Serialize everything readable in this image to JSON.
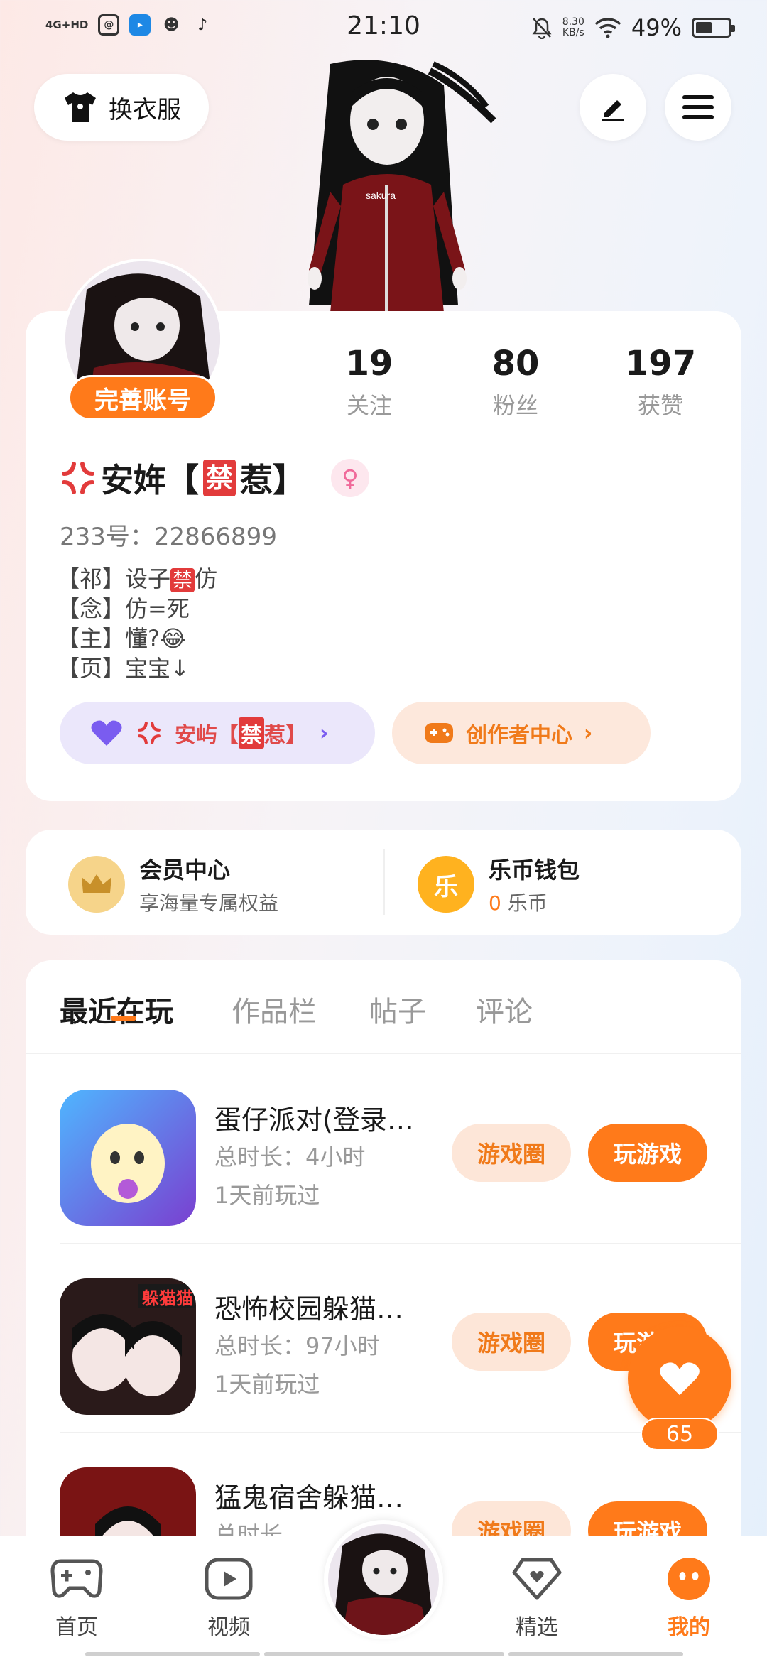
{
  "status_bar": {
    "network": "4G+HD",
    "time": "21:10",
    "speed_value": "8.30",
    "speed_unit": "KB/s",
    "battery": "49%"
  },
  "top": {
    "dress_label": "换衣服"
  },
  "profile": {
    "complete_label": "完善账号",
    "stats": [
      {
        "value": "19",
        "label": "关注"
      },
      {
        "value": "80",
        "label": "粉丝"
      },
      {
        "value": "197",
        "label": "获赞"
      }
    ],
    "name_part1": "安姩【",
    "name_chip": "禁",
    "name_part2": "惹】",
    "uid": "233号：22866899",
    "bio": [
      {
        "prefix": "【祁】设子",
        "chip": "禁",
        "suffix": "仿"
      },
      {
        "prefix": "【念】仿=死",
        "chip": "",
        "suffix": ""
      },
      {
        "prefix": "【主】懂?😂",
        "chip": "",
        "suffix": ""
      },
      {
        "prefix": "【页】宝宝↓",
        "chip": "",
        "suffix": ""
      }
    ],
    "group_pill": {
      "part1": "安屿【",
      "chip": "禁",
      "part2": "惹】"
    },
    "creator_pill": "创作者中心"
  },
  "vip": {
    "member_title": "会员中心",
    "member_sub": "享海量专属权益",
    "wallet_title": "乐币钱包",
    "wallet_amount": "0",
    "wallet_unit": "乐币",
    "wallet_icon_char": "乐"
  },
  "tabs": [
    "最近在玩",
    "作品栏",
    "帖子",
    "评论"
  ],
  "games": [
    {
      "name": "蛋仔派对(登录…",
      "duration": "总时长：4小时",
      "last": "1天前玩过",
      "circle_label": "游戏圈",
      "play_label": "玩游戏",
      "icon_text": ""
    },
    {
      "name": "恐怖校园躲猫…",
      "duration": "总时长：97小时",
      "last": "1天前玩过",
      "circle_label": "游戏圈",
      "play_label": "玩游戏",
      "icon_text": "躲猫猫"
    },
    {
      "name": "猛鬼宿舍躲猫…",
      "duration": "总时长",
      "last": "",
      "circle_label": "游戏圈",
      "play_label": "玩游戏",
      "icon_text": ""
    }
  ],
  "fab": {
    "count": "65"
  },
  "bottom_nav": [
    {
      "label": "首页"
    },
    {
      "label": "视频"
    },
    {
      "label": "精选"
    },
    {
      "label": "我的"
    }
  ],
  "colors": {
    "accent": "#ff7a1a",
    "red_chip": "#e23b3b",
    "group_pill_bg": "#ebe7fb",
    "creator_pill_bg": "#fde8dc"
  }
}
